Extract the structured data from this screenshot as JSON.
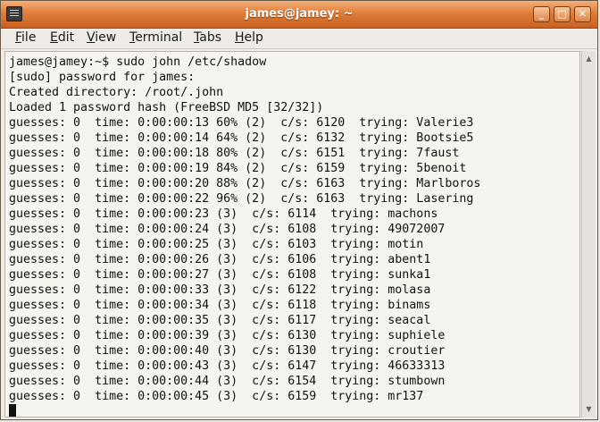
{
  "window": {
    "title": "james@jamey: ~"
  },
  "menubar": {
    "items": [
      {
        "first": "F",
        "rest": "ile"
      },
      {
        "first": "E",
        "rest": "dit"
      },
      {
        "first": "V",
        "rest": "iew"
      },
      {
        "first": "T",
        "rest": "erminal"
      },
      {
        "first": "T",
        "rest": "abs"
      },
      {
        "first": "H",
        "rest": "elp"
      }
    ]
  },
  "terminal": {
    "lines": [
      "james@jamey:~$ sudo john /etc/shadow",
      "[sudo] password for james:",
      "Created directory: /root/.john",
      "Loaded 1 password hash (FreeBSD MD5 [32/32])",
      "guesses: 0  time: 0:00:00:13 60% (2)  c/s: 6120  trying: Valerie3",
      "guesses: 0  time: 0:00:00:14 64% (2)  c/s: 6132  trying: Bootsie5",
      "guesses: 0  time: 0:00:00:18 80% (2)  c/s: 6151  trying: 7faust",
      "guesses: 0  time: 0:00:00:19 84% (2)  c/s: 6159  trying: 5benoit",
      "guesses: 0  time: 0:00:00:20 88% (2)  c/s: 6163  trying: Marlboros",
      "guesses: 0  time: 0:00:00:22 96% (2)  c/s: 6163  trying: Lasering",
      "guesses: 0  time: 0:00:00:23 (3)  c/s: 6114  trying: machons",
      "guesses: 0  time: 0:00:00:24 (3)  c/s: 6108  trying: 49072007",
      "guesses: 0  time: 0:00:00:25 (3)  c/s: 6103  trying: motin",
      "guesses: 0  time: 0:00:00:26 (3)  c/s: 6106  trying: abent1",
      "guesses: 0  time: 0:00:00:27 (3)  c/s: 6108  trying: sunka1",
      "guesses: 0  time: 0:00:00:33 (3)  c/s: 6122  trying: molasa",
      "guesses: 0  time: 0:00:00:34 (3)  c/s: 6118  trying: binams",
      "guesses: 0  time: 0:00:00:35 (3)  c/s: 6117  trying: seacal",
      "guesses: 0  time: 0:00:00:39 (3)  c/s: 6130  trying: suphiele",
      "guesses: 0  time: 0:00:00:40 (3)  c/s: 6130  trying: croutier",
      "guesses: 0  time: 0:00:00:43 (3)  c/s: 6147  trying: 46633313",
      "guesses: 0  time: 0:00:00:44 (3)  c/s: 6154  trying: stumbown",
      "guesses: 0  time: 0:00:00:45 (3)  c/s: 6159  trying: mr137"
    ]
  },
  "icons": {
    "window_menu": "terminal-icon",
    "minimize": "minimize-icon",
    "maximize": "maximize-icon",
    "close": "close-icon"
  },
  "colors": {
    "titlebar": "#e07d3a",
    "terminal_bg": "#f5f4ef",
    "text": "#111111"
  }
}
